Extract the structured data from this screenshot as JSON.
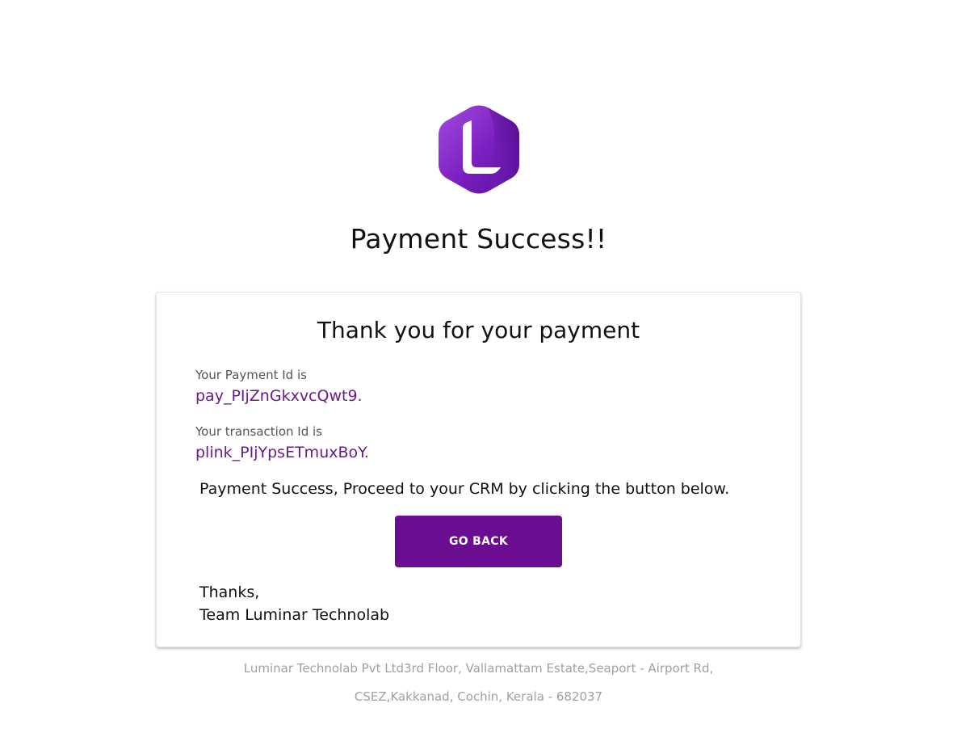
{
  "brand": {
    "logo_icon": "luminar-hexagon-L-logo",
    "logo_color_dark": "#5a0f9a",
    "logo_color_light": "#a44ae0"
  },
  "page": {
    "title": "Payment Success!!"
  },
  "card": {
    "heading": "Thank you for your payment",
    "payment_id_label": "Your Payment Id is",
    "payment_id_value": "pay_PIjZnGkxvcQwt9.",
    "transaction_id_label": "Your transaction Id is",
    "transaction_id_value": "plink_PIjYpsETmuxBoY.",
    "message": "Payment Success, Proceed to your CRM by clicking the button below.",
    "button_label": "GO BACK",
    "signoff_line1": "Thanks,",
    "signoff_line2": "Team Luminar Technolab"
  },
  "footer": {
    "address_line1": "Luminar Technolab Pvt Ltd3rd Floor, Vallamattam Estate,Seaport - Airport Rd,",
    "address_line2": "CSEZ,Kakkanad, Cochin, Kerala - 682037"
  },
  "colors": {
    "accent": "#6a0d91",
    "id_text": "#6a1a8a",
    "footer_text": "#a0a0a0"
  }
}
